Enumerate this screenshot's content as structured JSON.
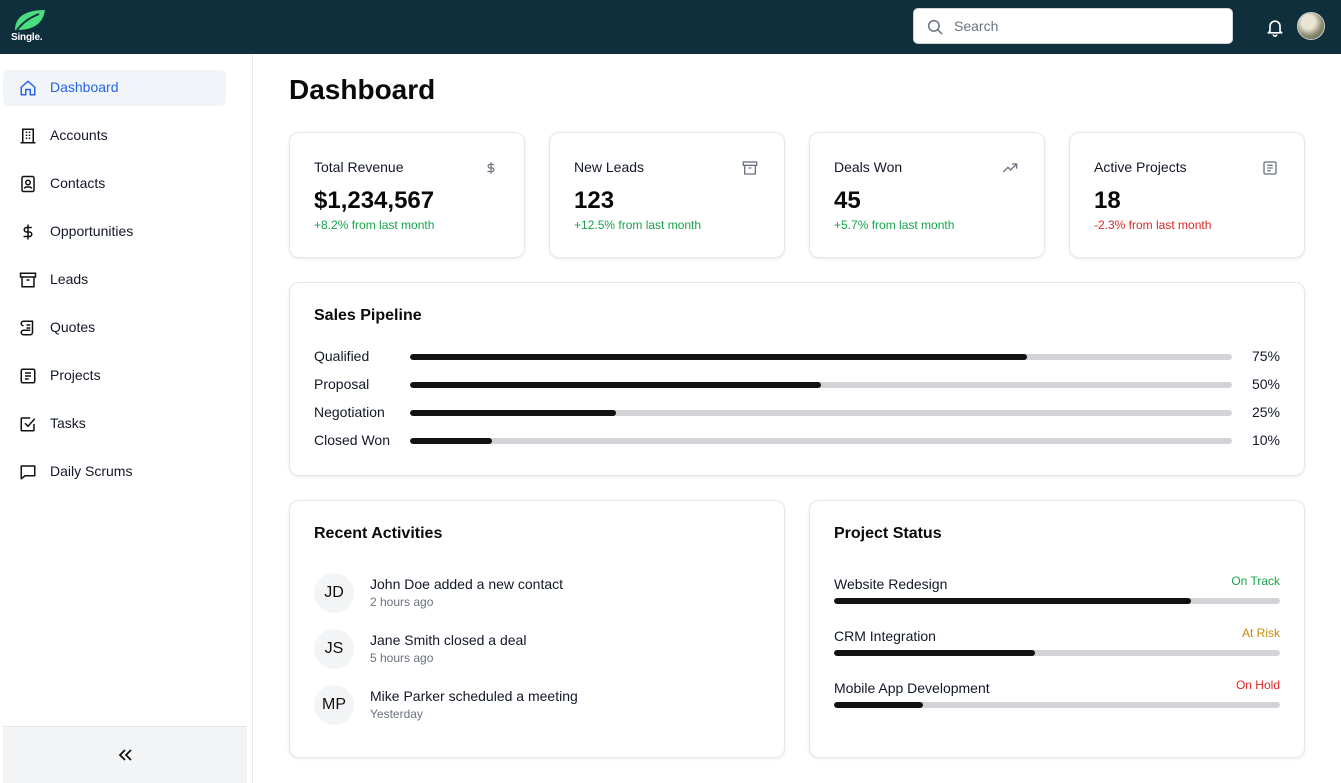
{
  "app": {
    "logo_text": "Single."
  },
  "header": {
    "search_placeholder": "Search"
  },
  "sidebar": {
    "items": [
      {
        "label": "Dashboard",
        "icon": "home-icon",
        "active": true
      },
      {
        "label": "Accounts",
        "icon": "building-icon"
      },
      {
        "label": "Contacts",
        "icon": "contact-book-icon"
      },
      {
        "label": "Opportunities",
        "icon": "dollar-icon"
      },
      {
        "label": "Leads",
        "icon": "archive-icon"
      },
      {
        "label": "Quotes",
        "icon": "scroll-icon"
      },
      {
        "label": "Projects",
        "icon": "list-document-icon"
      },
      {
        "label": "Tasks",
        "icon": "checkbox-icon"
      },
      {
        "label": "Daily Scrums",
        "icon": "message-icon"
      }
    ]
  },
  "main": {
    "title": "Dashboard",
    "stats": [
      {
        "label": "Total Revenue",
        "value": "$1,234,567",
        "change": "+8.2% from last month",
        "trend": "positive",
        "icon": "dollar-icon"
      },
      {
        "label": "New Leads",
        "value": "123",
        "change": "+12.5% from last month",
        "trend": "positive",
        "icon": "archive-icon"
      },
      {
        "label": "Deals Won",
        "value": "45",
        "change": "+5.7% from last month",
        "trend": "positive",
        "icon": "trending-up-icon"
      },
      {
        "label": "Active Projects",
        "value": "18",
        "change": "-2.3% from last month",
        "trend": "negative",
        "icon": "list-document-icon"
      }
    ],
    "pipeline": {
      "title": "Sales Pipeline",
      "stages": [
        {
          "label": "Qualified",
          "percent_text": "75%",
          "value": 0.75
        },
        {
          "label": "Proposal",
          "percent_text": "50%",
          "value": 0.5
        },
        {
          "label": "Negotiation",
          "percent_text": "25%",
          "value": 0.25
        },
        {
          "label": "Closed Won",
          "percent_text": "10%",
          "value": 0.1
        }
      ]
    },
    "activities": {
      "title": "Recent Activities",
      "items": [
        {
          "initials": "JD",
          "text": "John Doe added a new contact",
          "time": "2 hours ago"
        },
        {
          "initials": "JS",
          "text": "Jane Smith closed a deal",
          "time": "5 hours ago"
        },
        {
          "initials": "MP",
          "text": "Mike Parker scheduled a meeting",
          "time": "Yesterday"
        }
      ]
    },
    "project_status": {
      "title": "Project Status",
      "items": [
        {
          "name": "Website Redesign",
          "status": "On Track",
          "status_color": "#16a34a",
          "progress": 0.8
        },
        {
          "name": "CRM Integration",
          "status": "At Risk",
          "status_color": "#ca8a04",
          "progress": 0.45
        },
        {
          "name": "Mobile App Development",
          "status": "On Hold",
          "status_color": "#dc2626",
          "progress": 0.2
        }
      ]
    }
  }
}
